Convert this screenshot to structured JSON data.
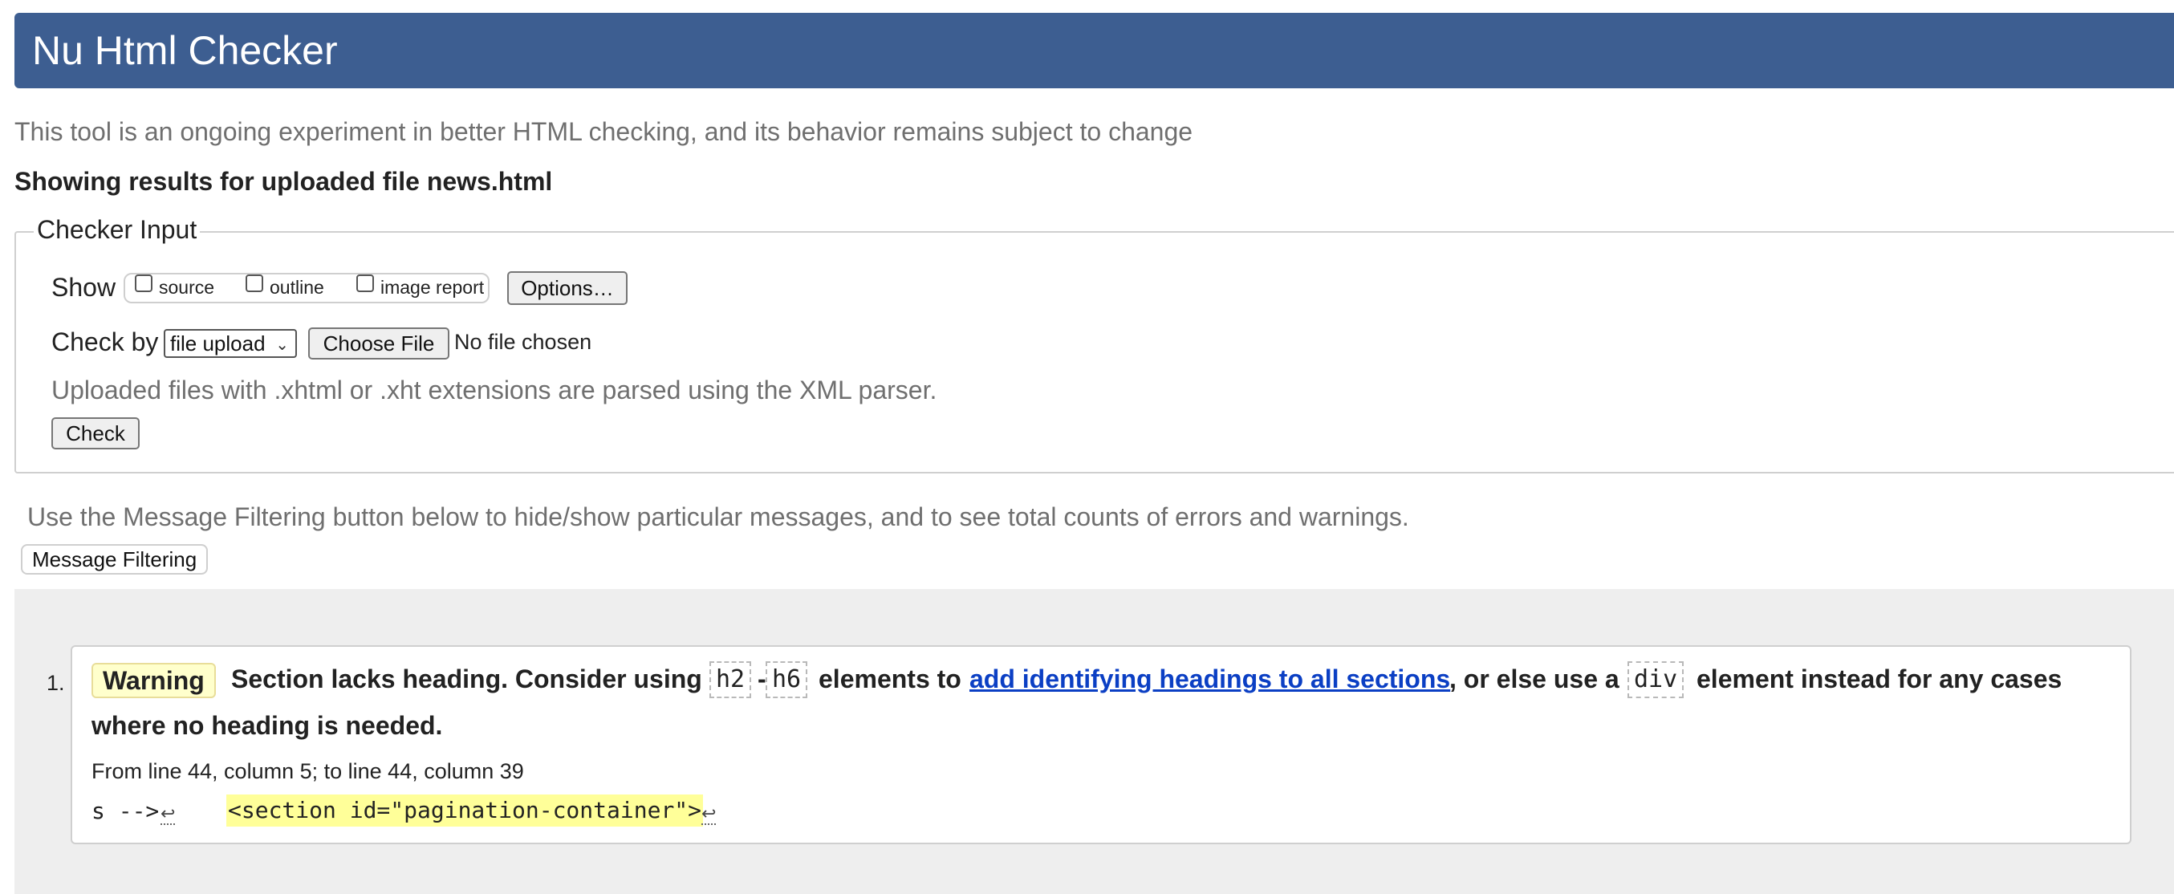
{
  "header": {
    "title": "Nu Html Checker"
  },
  "intro": "This tool is an ongoing experiment in better HTML checking, and its behavior remains subject to change",
  "results_heading": "Showing results for uploaded file news.html",
  "checker_input": {
    "legend": "Checker Input",
    "show_label": "Show",
    "show_options": [
      "source",
      "outline",
      "image report"
    ],
    "options_button": "Options…",
    "check_by_label": "Check by",
    "check_by_value": "file upload",
    "choose_file_button": "Choose File",
    "no_file_text": "No file chosen",
    "xml_note": "Uploaded files with .xhtml or .xht extensions are parsed using the XML parser.",
    "check_button": "Check"
  },
  "filter_note": "Use the Message Filtering button below to hide/show particular messages, and to see total counts of errors and warnings.",
  "filter_button": "Message Filtering",
  "messages": [
    {
      "number": "1.",
      "type": "Warning",
      "text_1": "Section lacks heading. Consider using",
      "code_1": "h2",
      "dash": "-",
      "code_2": "h6",
      "text_2": "elements to",
      "link": "add identifying headings to all sections",
      "text_3": ", or else use a",
      "code_3": "div",
      "text_4": "element instead for any cases",
      "text_5": "where no heading is needed.",
      "location": "From line 44, column 5; to line 44, column 39",
      "extract_before": "s -->",
      "extract_highlight": "<section id=\"pagination-container\">",
      "line_feed": "↩"
    }
  ]
}
